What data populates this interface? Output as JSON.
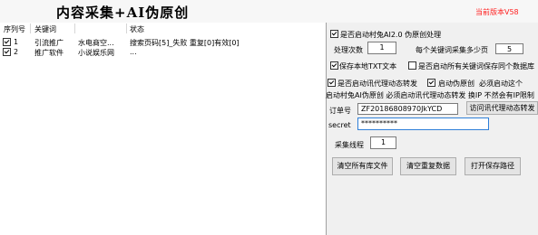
{
  "app": {
    "title": "内容采集+AI伪原创",
    "version": "当前版本V58"
  },
  "list": {
    "columns": [
      "序列号",
      "关键词",
      "",
      "状态"
    ],
    "rows": [
      {
        "checked": true,
        "index": "1",
        "keyword": "引流推广",
        "extra": "水电商空...",
        "status": "搜索页码[5]_失败 重复[0]有效[0]"
      },
      {
        "checked": true,
        "index": "2",
        "keyword": "推广软件",
        "extra": "小说娱乐网",
        "status": "..."
      }
    ]
  },
  "settings": {
    "ai_checkbox": {
      "checked": true,
      "label": "是否启动村兔AI2.0 伪原创处理"
    },
    "process_count": {
      "label": "处理次数",
      "value": "1"
    },
    "keyword_pages": {
      "label": "每个关键词采集多少页",
      "value": "5"
    },
    "save_txt": {
      "checked": true,
      "label": "保存本地TXT文本"
    },
    "save_same_file": {
      "checked": false,
      "label": "是否启动所有关键词保存同个数据库"
    },
    "proxy_forward": {
      "checked": true,
      "label": "是否启动讯代理动态转发"
    },
    "pseudo_original": {
      "checked": true,
      "label": "启动伪原创"
    },
    "pseudo_note": "必须启动这个",
    "notice": "启动村兔AI伪原创 必须启动讯代理动态转发 换IP 不然会有IP限制",
    "order": {
      "label": "订单号",
      "value": "ZF20186808970JkYCD"
    },
    "visit_button": "访问讯代理动态转发",
    "secret": {
      "label": "secret",
      "value": "**********"
    },
    "threads": {
      "label": "采集线程",
      "value": "1"
    }
  },
  "buttons": {
    "clear_files": "清空所有库文件",
    "clear_duplicates": "清空重复数据",
    "open_path": "打开保存路径"
  }
}
